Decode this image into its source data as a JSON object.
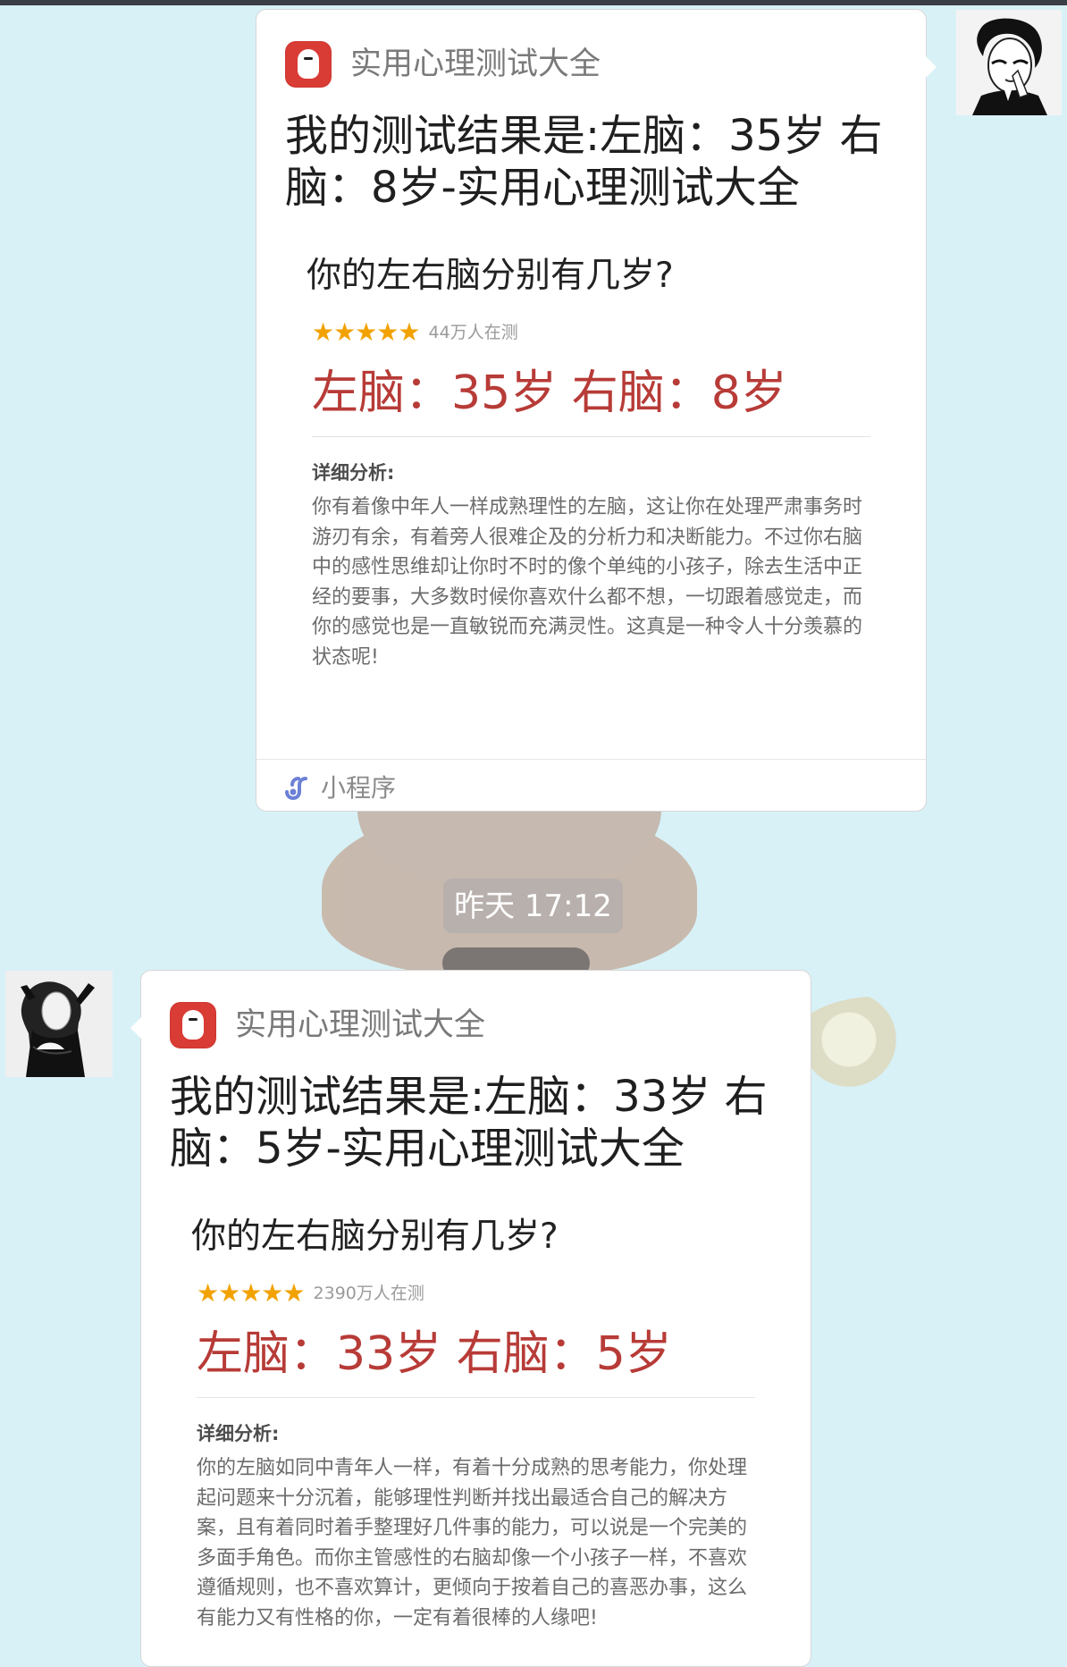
{
  "background": {
    "color": "#d8f1f7"
  },
  "messages": [
    {
      "side": "right",
      "mini_program_name": "实用心理测试大全",
      "title": "我的测试结果是:左脑：35岁 右脑：8岁-实用心理测试大全",
      "quiz_title": "你的左右脑分别有几岁?",
      "rating": "★★★★★",
      "participants": "44万人在测",
      "result_text": "左脑：35岁 右脑：8岁",
      "analysis_label": "详细分析:",
      "analysis_text": "你有着像中年人一样成熟理性的左脑，这让你在处理严肃事务时游刃有余，有着旁人很难企及的分析力和决断能力。不过你右脑中的感性思维却让你时不时的像个单纯的小孩子，除去生活中正经的要事，大多数时候你喜欢什么都不想，一切跟着感觉走，而你的感觉也是一直敏锐而充满灵性。这真是一种令人十分羡慕的状态呢!",
      "footer_label": "小程序"
    },
    {
      "side": "left",
      "mini_program_name": "实用心理测试大全",
      "title": "我的测试结果是:左脑：33岁 右脑：5岁-实用心理测试大全",
      "quiz_title": "你的左右脑分别有几岁?",
      "rating": "★★★★★",
      "participants": "2390万人在测",
      "result_text": "左脑：33岁 右脑：5岁",
      "analysis_label": "详细分析:",
      "analysis_text": "你的左脑如同中青年人一样，有着十分成熟的思考能力，你处理起问题来十分沉着，能够理性判断并找出最适合自己的解决方案，且有着同时着手整理好几件事的能力，可以说是一个完美的多面手角色。而你主管感性的右脑却像一个小孩子一样，不喜欢遵循规则，也不喜欢算计，更倾向于按着自己的喜恶办事，这么有能力又有性格的你，一定有着很棒的人缘吧!"
    }
  ],
  "timestamp": "昨天 17:12",
  "colors": {
    "accent_red": "#b73b37",
    "star_gold": "#f2a200",
    "mini_logo_red": "#d93b35",
    "time_pill": "#b7b0ad"
  },
  "icons": {
    "right_avatar": "avatar-man-icon",
    "left_avatar": "avatar-woman-icon",
    "mini_logo": "baymax-logo-icon",
    "footer_icon": "mini-program-icon"
  }
}
